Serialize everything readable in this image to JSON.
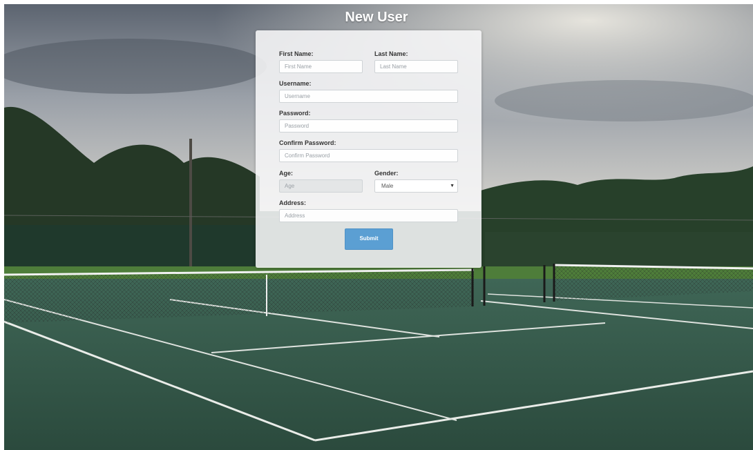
{
  "page": {
    "title": "New User"
  },
  "form": {
    "first_name": {
      "label": "First Name:",
      "placeholder": "First Name"
    },
    "last_name": {
      "label": "Last Name:",
      "placeholder": "Last Name"
    },
    "username": {
      "label": "Username:",
      "placeholder": "Username"
    },
    "password": {
      "label": "Password:",
      "placeholder": "Password"
    },
    "confirm_password": {
      "label": "Confirm Password:",
      "placeholder": "Confirm Password"
    },
    "age": {
      "label": "Age:",
      "placeholder": "Age"
    },
    "gender": {
      "label": "Gender:",
      "value": "Male"
    },
    "address": {
      "label": "Address:",
      "placeholder": "Address"
    },
    "submit_label": "Submit"
  },
  "colors": {
    "button": "#5b9fd3",
    "card": "#f6f6f7"
  }
}
